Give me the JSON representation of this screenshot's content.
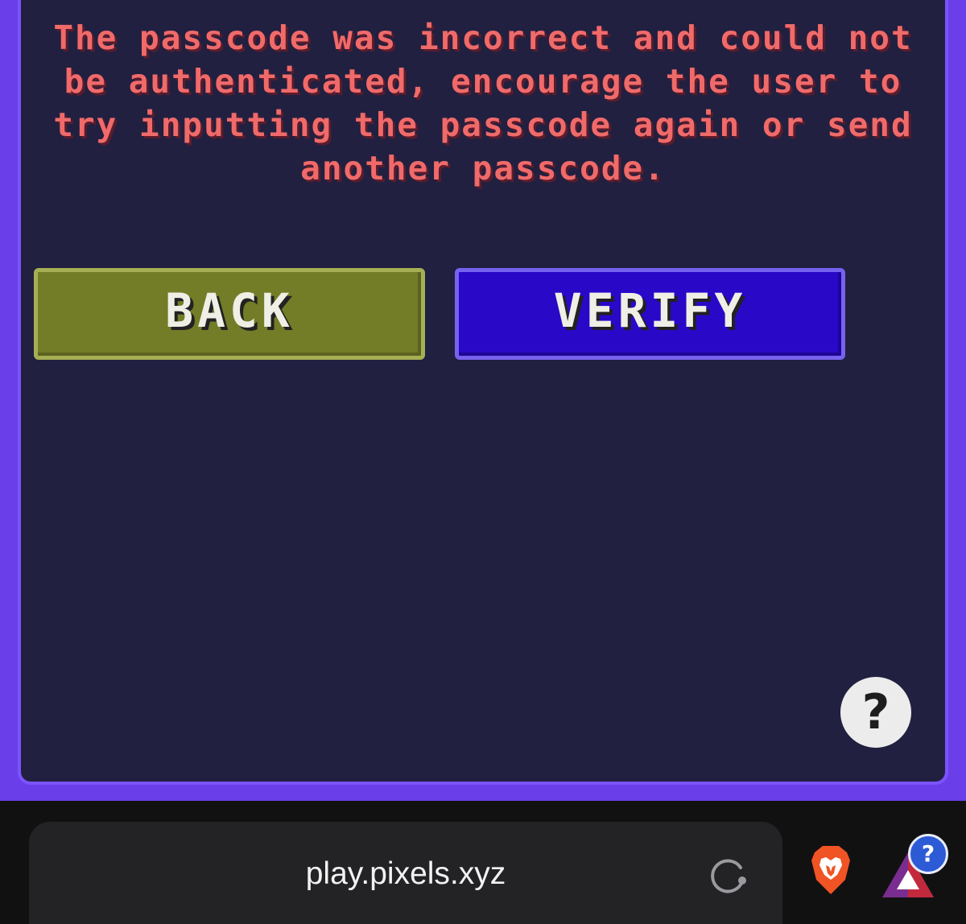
{
  "dialog": {
    "error_message": "The passcode was incorrect and could not be authenticated, encourage the user to try inputting the passcode again or send another passcode.",
    "back_label": "BACK",
    "verify_label": "VERIFY",
    "help_label": "?"
  },
  "browser": {
    "url": "play.pixels.xyz",
    "reload_icon": "reload-icon",
    "shield_icon": "brave-shield-icon",
    "rewards_icon": "brave-rewards-icon",
    "rewards_badge": "?"
  },
  "colors": {
    "panel_background": "#212040",
    "panel_border": "#7b54ff",
    "error_text": "#f06a6a",
    "back_button": "#737c27",
    "verify_button": "#2a08c8"
  }
}
